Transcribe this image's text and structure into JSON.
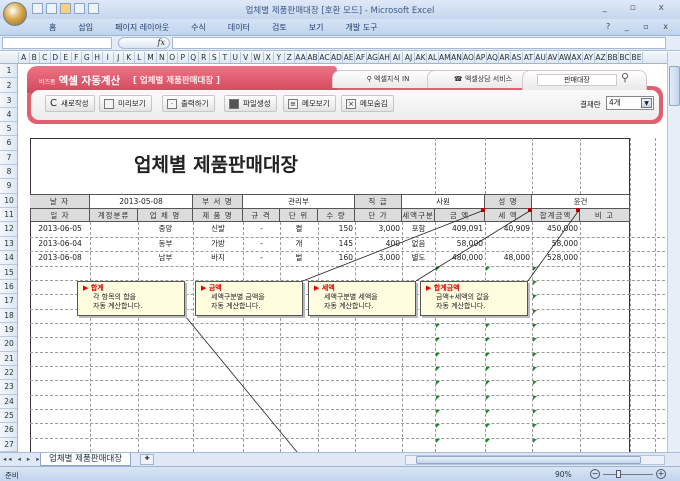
{
  "window": {
    "title": "업체별 제품판매대장  [호환 모드] - Microsoft Excel",
    "controls": "_ ▫ x"
  },
  "ribbon_tabs": [
    "홈",
    "삽입",
    "페이지 레이아웃",
    "수식",
    "데이터",
    "검토",
    "보기",
    "개발 도구"
  ],
  "ribbon_right": "? _ ▫ x",
  "formula": {
    "fx": "fx",
    "name_box": "",
    "value": ""
  },
  "columns": [
    "A",
    "B",
    "C",
    "D",
    "E",
    "F",
    "G",
    "H",
    "I",
    "J",
    "K",
    "L",
    "M",
    "N",
    "O",
    "P",
    "Q",
    "R",
    "S",
    "T",
    "U",
    "V",
    "W",
    "X",
    "Y",
    "Z",
    "AA",
    "AB",
    "AC",
    "AD",
    "AE",
    "AF",
    "AG",
    "AH",
    "AI",
    "AJ",
    "AK",
    "AL",
    "AM",
    "AN",
    "AO",
    "AP",
    "AQ",
    "AR",
    "AS",
    "AT",
    "AU",
    "AV",
    "AW",
    "AX",
    "AY",
    "AZ",
    "BB",
    "BC",
    "BE"
  ],
  "rows": [
    "1",
    "2",
    "3",
    "4",
    "5",
    "6",
    "7",
    "8",
    "9",
    "10",
    "11",
    "12",
    "13",
    "14",
    "15",
    "16",
    "17",
    "18",
    "19",
    "20",
    "21",
    "22",
    "23",
    "24",
    "25",
    "26",
    "27"
  ],
  "banner": {
    "brand_small": "비즈폼",
    "brand": "엑셀 자동계산",
    "subtitle": "[ 업체별 제품판매대장 ]",
    "tab1": "엑셀지식 IN",
    "tab2": "엑셀상담 서비스",
    "search_value": "판매대장",
    "buttons": [
      "새로작성",
      "미리보기",
      "출력하기",
      "파일생성",
      "메모보기",
      "메모숨김"
    ],
    "count_label": "결재란",
    "count_value": "4개"
  },
  "sheet": {
    "title": "업체별 제품판매대장",
    "info": {
      "date_label": "날 자",
      "date": "2013-05-08",
      "dept_label": "부 서 명",
      "dept": "관리부",
      "rank_label": "직 급",
      "rank": "사원",
      "name_label": "성 명",
      "name": "윤건"
    },
    "headers": [
      "일 자",
      "계정분류",
      "업 체 명",
      "제 품 명",
      "규 격",
      "단 위",
      "수 량",
      "단 가",
      "세액구분",
      "금 액",
      "세 액",
      "합계금액",
      "비 고"
    ],
    "rows": [
      [
        "2013-06-05",
        "",
        "중앙",
        "신발",
        "-",
        "켤",
        "150",
        "3,000",
        "포함",
        "409,091",
        "40,909",
        "450,000",
        ""
      ],
      [
        "2013-06-04",
        "",
        "동부",
        "가방",
        "-",
        "개",
        "145",
        "400",
        "없음",
        "58,000",
        "",
        "58,000",
        ""
      ],
      [
        "2013-06-08",
        "",
        "남부",
        "바지",
        "-",
        "벌",
        "160",
        "3,000",
        "별도",
        "480,000",
        "48,000",
        "528,000",
        ""
      ]
    ]
  },
  "notes": [
    {
      "title": "▶ 합계",
      "lines": [
        "각 항목의 합을",
        "자동 계산합니다."
      ]
    },
    {
      "title": "▶ 금액",
      "lines": [
        "세액구분별 금액을",
        "자동 계산합니다."
      ]
    },
    {
      "title": "▶ 세액",
      "lines": [
        "세액구분별 세액을",
        "자동 계산합니다."
      ]
    },
    {
      "title": "▶ 합계금액",
      "lines": [
        "금액+세액의 값을",
        "자동 계산합니다."
      ]
    }
  ],
  "sheet_tab": "업체별 제품판매대장",
  "status": {
    "ready": "준비",
    "zoom": "90%"
  }
}
